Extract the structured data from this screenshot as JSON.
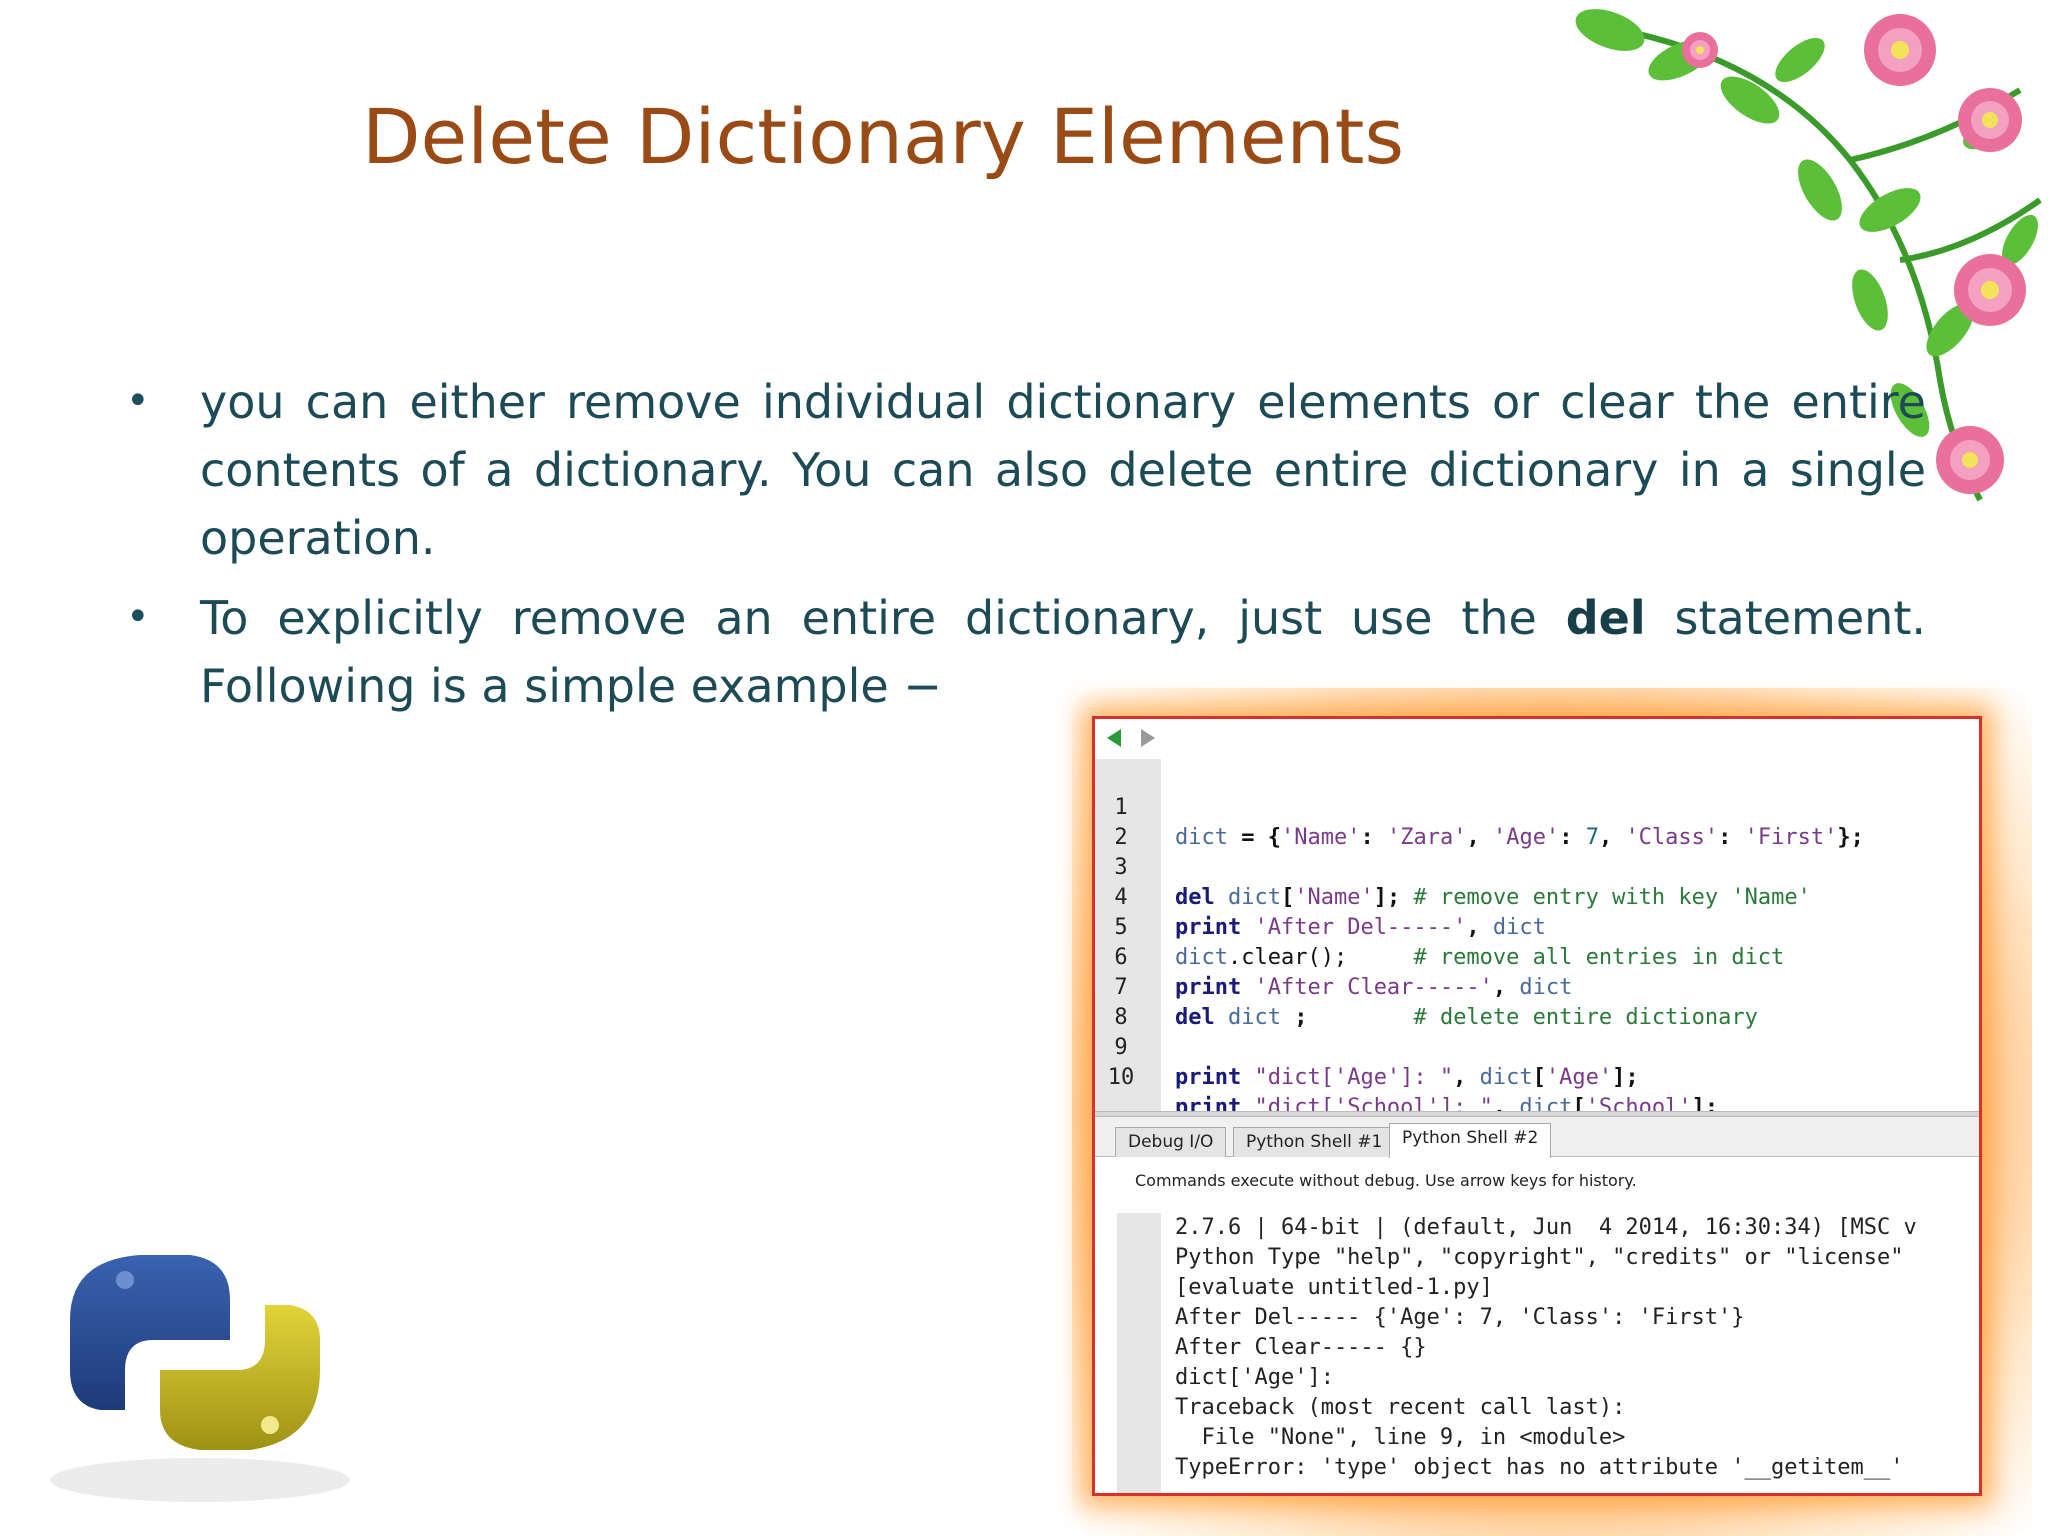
{
  "slide": {
    "title": "Delete Dictionary Elements",
    "bullets": [
      {
        "marker": "•",
        "line1": "you can either remove individual dictionary elements or clear the entire contents of a dictionary. You can also delete entire dictionary in a single operation."
      },
      {
        "marker": "•",
        "before": "To explicitly remove an entire dictionary, just use the ",
        "bold": "del",
        "after": " statement. Following is a simple example −"
      }
    ]
  },
  "ide": {
    "code_lines": [
      {
        "n": "1"
      },
      {
        "n": "2"
      },
      {
        "n": "3"
      },
      {
        "n": "4"
      },
      {
        "n": "5"
      },
      {
        "n": "6"
      },
      {
        "n": "7"
      },
      {
        "n": "8"
      },
      {
        "n": "9"
      },
      {
        "n": "10"
      }
    ],
    "tabs": [
      "Debug I/O",
      "Python Shell #1",
      "Python Shell #2"
    ],
    "active_tab": "Python Shell #2",
    "shell_info": "Commands execute without debug.  Use arrow keys for history.",
    "shell_lines": [
      "2.7.6 | 64-bit | (default, Jun  4 2014, 16:30:34) [MSC v",
      "Python Type \"help\", \"copyright\", \"credits\" or \"license\"",
      "[evaluate untitled-1.py]",
      "After Del----- {'Age': 7, 'Class': 'First'}",
      "After Clear----- {}",
      "dict['Age']:",
      "Traceback (most recent call last):",
      "  File \"None\", line 9, in <module>",
      "TypeError: 'type' object has no attribute '__getitem__'"
    ]
  },
  "colors": {
    "title": "#9a4a14",
    "body_text": "#1c4b57",
    "ide_border": "#d8302a",
    "glow": "#ff9628"
  },
  "icons": [
    "flower-decoration",
    "python-logo",
    "back-arrow-icon",
    "forward-arrow-icon"
  ]
}
